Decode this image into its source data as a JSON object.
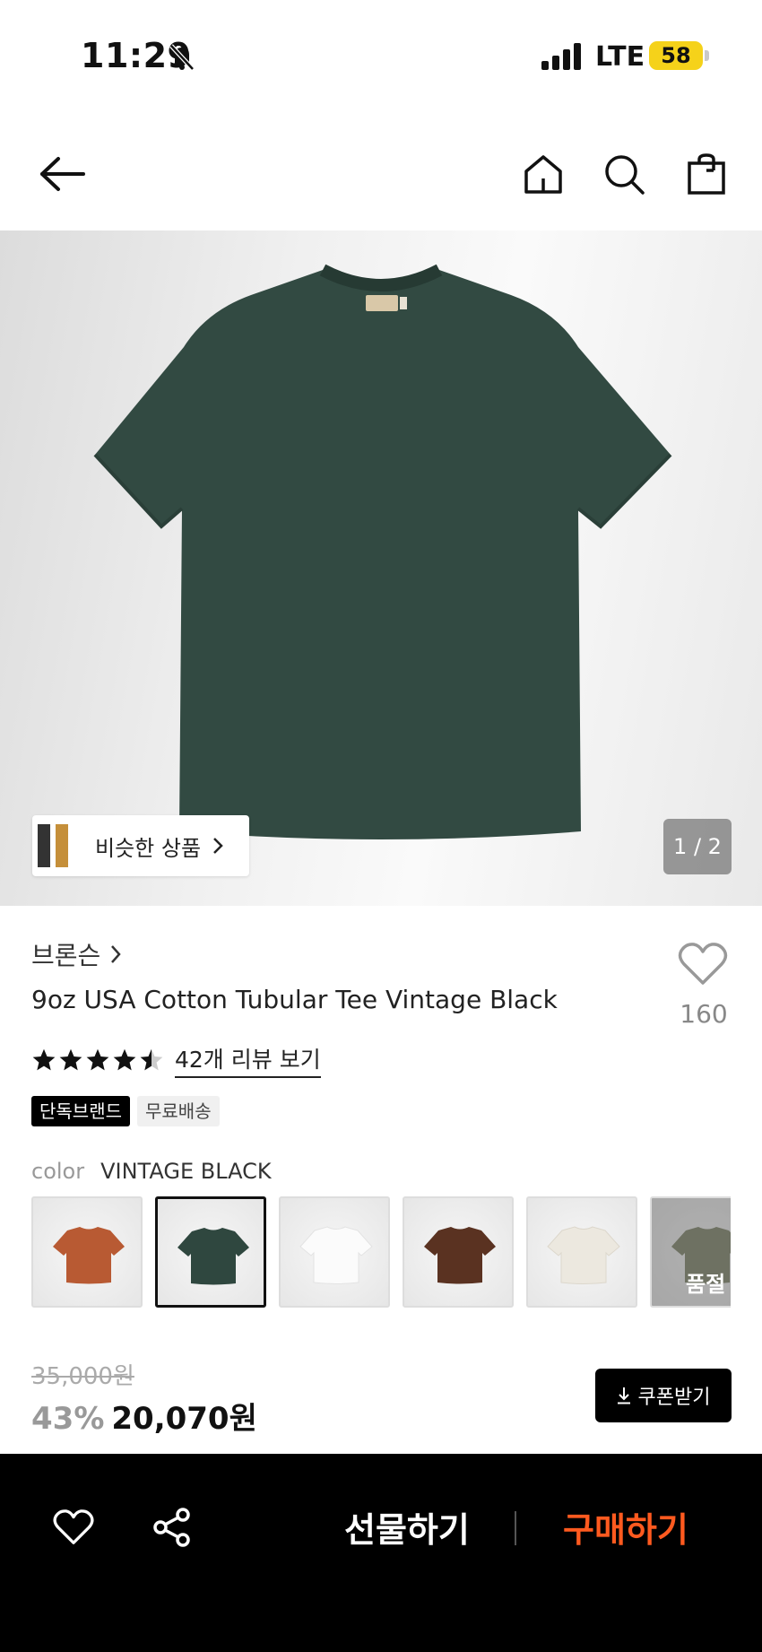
{
  "status_bar": {
    "time": "11:29",
    "network": "LTE",
    "battery": "58"
  },
  "hero": {
    "similar_label": "비슷한 상품",
    "pager": "1 / 2"
  },
  "product": {
    "brand": "브론슨",
    "title": "9oz USA Cotton Tubular Tee Vintage Black",
    "like_count": "160",
    "rating": 4.5,
    "review_link": "42개 리뷰 보기",
    "tags": [
      "단독브랜드",
      "무료배송"
    ],
    "color_label": "color",
    "color_value": "VINTAGE BLACK"
  },
  "swatches": [
    {
      "color": "#b85a33",
      "selected": false,
      "sold_out": false
    },
    {
      "color": "#2f473f",
      "selected": true,
      "sold_out": false
    },
    {
      "color": "#f7f7f7",
      "selected": false,
      "sold_out": false
    },
    {
      "color": "#5a3221",
      "selected": false,
      "sold_out": false
    },
    {
      "color": "#ece8df",
      "selected": false,
      "sold_out": false
    },
    {
      "color": "#7e8468",
      "selected": false,
      "sold_out": true,
      "sold_out_label": "품절"
    }
  ],
  "pricing": {
    "original": "35,000원",
    "discount": "43%",
    "price": "20,070원",
    "coupon_label": "쿠폰받기"
  },
  "bottom_bar": {
    "gift_label": "선물하기",
    "buy_label": "구매하기"
  },
  "colors": {
    "accent": "#ff5a1f",
    "tee": "#324a42"
  }
}
